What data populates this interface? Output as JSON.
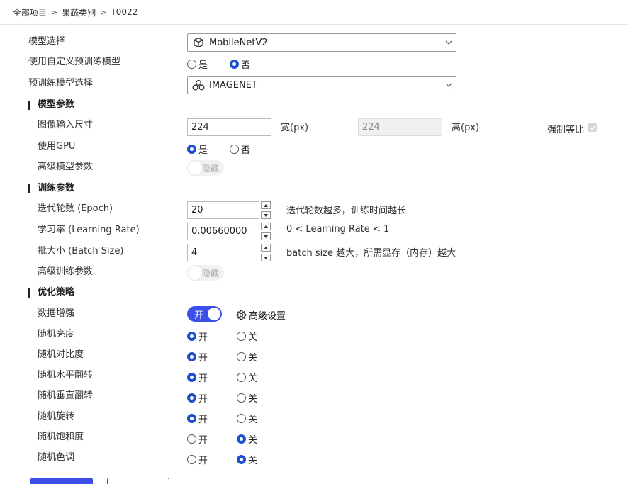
{
  "breadcrumb": [
    "全部项目",
    "果蔬类别",
    "T0022"
  ],
  "breadcrumb_separator": ">",
  "model_select": {
    "label": "模型选择",
    "value": "MobileNetV2",
    "icon": "cube-icon"
  },
  "custom_pretrained": {
    "label": "使用自定义预训练模型",
    "options": [
      "是",
      "否"
    ],
    "selected": "否"
  },
  "pretrained_select": {
    "label": "预训练模型选择",
    "value": "IMAGENET",
    "icon": "nodes-icon"
  },
  "model_params": {
    "section": "模型参数",
    "image_size": {
      "label": "图像输入尺寸",
      "width": "224",
      "width_unit": "宽(px)",
      "height": "224",
      "height_unit": "高(px)",
      "force_ratio": "强制等比",
      "force_ratio_checked": true
    },
    "use_gpu": {
      "label": "使用GPU",
      "options": [
        "是",
        "否"
      ],
      "selected": "是"
    },
    "advanced": {
      "label": "高级模型参数",
      "state_text": "隐藏"
    }
  },
  "train_params": {
    "section": "训练参数",
    "epoch": {
      "label": "迭代轮数 (Epoch)",
      "value": "20",
      "hint": "迭代轮数越多，训练时间越长"
    },
    "lr": {
      "label": "学习率 (Learning Rate)",
      "value": "0.00660000",
      "hint": "0 < Learning Rate < 1"
    },
    "batch": {
      "label": "批大小 (Batch Size)",
      "value": "4",
      "hint": "batch size 越大，所需显存（内存）越大"
    },
    "advanced": {
      "label": "高级训练参数",
      "state_text": "隐藏"
    }
  },
  "optimization": {
    "section": "优化策略",
    "augmentation": {
      "label": "数据增强",
      "toggle_text": "开",
      "toggle_on": true,
      "advanced_link": "高级设置"
    },
    "on_label": "开",
    "off_label": "关",
    "items": [
      {
        "label": "随机亮度",
        "selected": "on"
      },
      {
        "label": "随机对比度",
        "selected": "on"
      },
      {
        "label": "随机水平翻转",
        "selected": "on"
      },
      {
        "label": "随机垂直翻转",
        "selected": "on"
      },
      {
        "label": "随机旋转",
        "selected": "on"
      },
      {
        "label": "随机饱和度",
        "selected": "off"
      },
      {
        "label": "随机色调",
        "selected": "off"
      }
    ]
  },
  "colors": {
    "accent": "#3b4fe8",
    "radio": "#1d4fcf"
  }
}
